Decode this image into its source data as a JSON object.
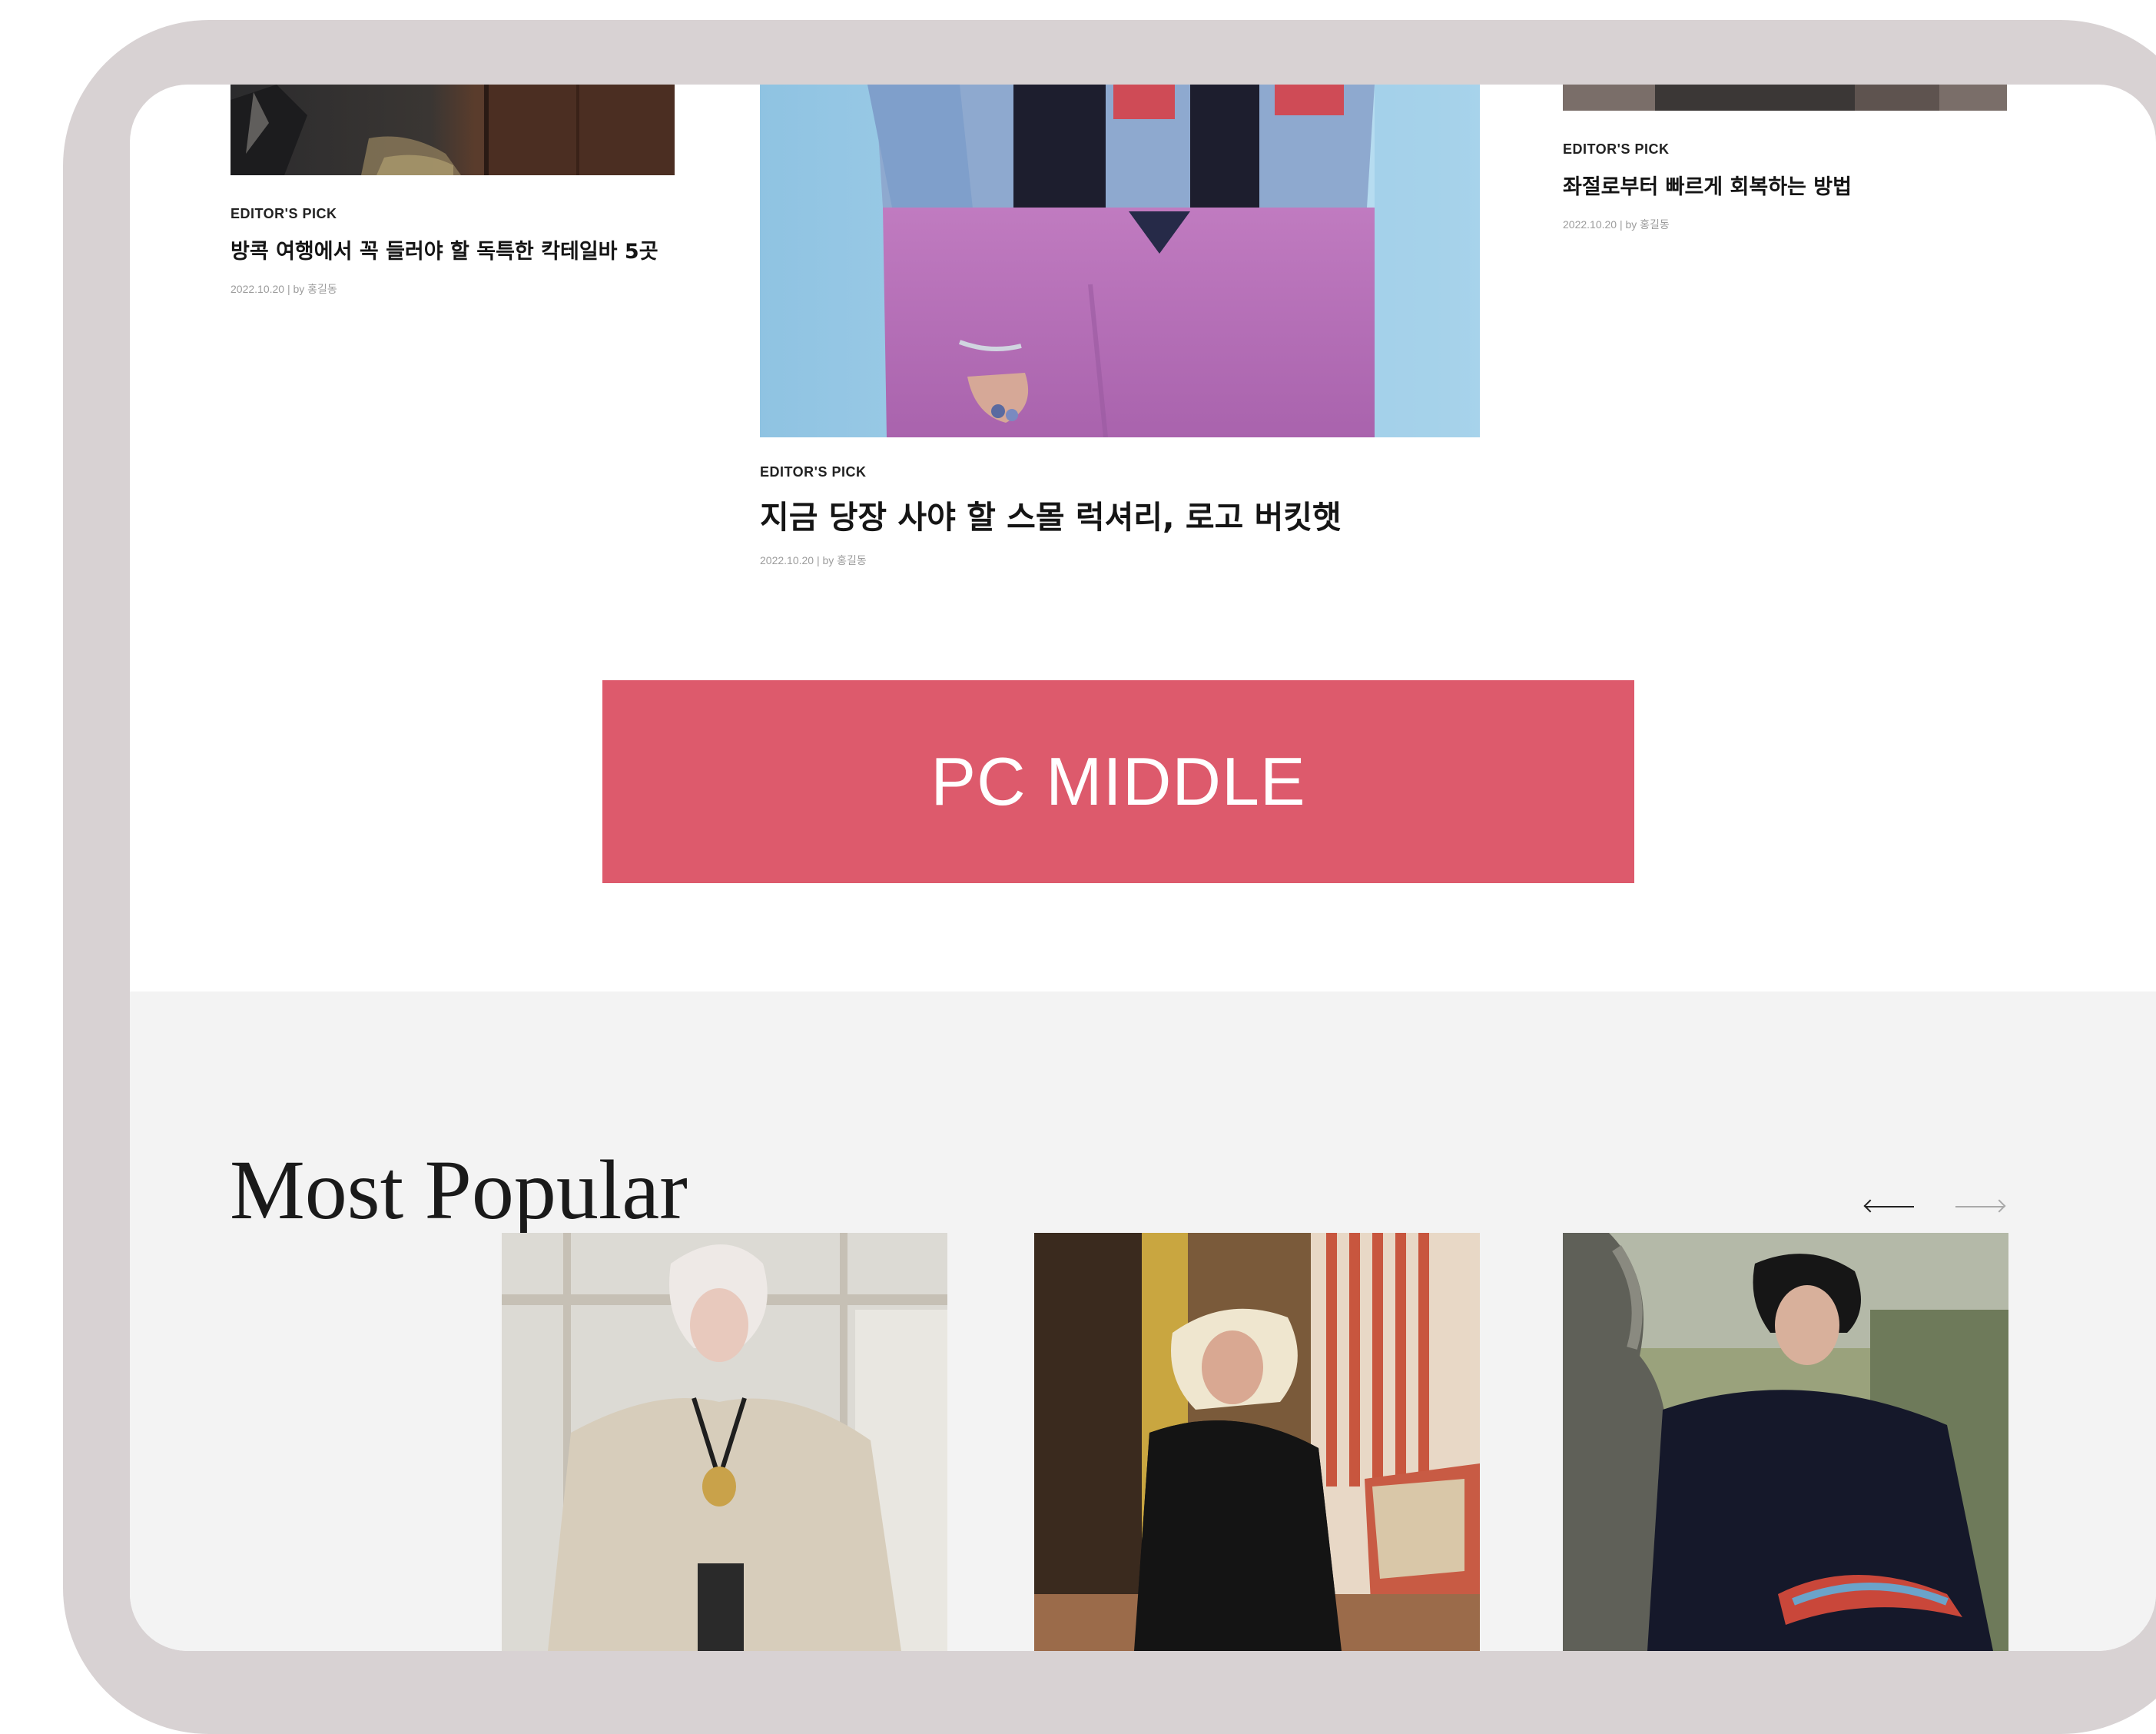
{
  "cards": [
    {
      "kicker": "EDITOR'S PICK",
      "title": "방콕 여행에서 꼭 들러야 할 독특한 칵테일바 5곳",
      "meta": "2022.10.20 | by 홍길동"
    },
    {
      "kicker": "EDITOR'S PICK",
      "title": "지금 당장 사야 할 스몰 럭셔리, 로고 버킷햇",
      "meta": "2022.10.20 | by 홍길동"
    },
    {
      "kicker": "EDITOR'S PICK",
      "title": "좌절로부터 빠르게 회복하는 방법",
      "meta": "2022.10.20 | by 홍길동"
    }
  ],
  "ad": {
    "label": "PC MIDDLE",
    "color": "#dd5a6c"
  },
  "popular": {
    "title": "Most Popular",
    "prev_icon": "arrow-left-icon",
    "next_icon": "arrow-right-icon"
  },
  "colors": {
    "device_frame": "#d8d2d3",
    "popular_bg": "#f3f3f3",
    "text": "#151515",
    "meta": "#9c9c9c"
  }
}
